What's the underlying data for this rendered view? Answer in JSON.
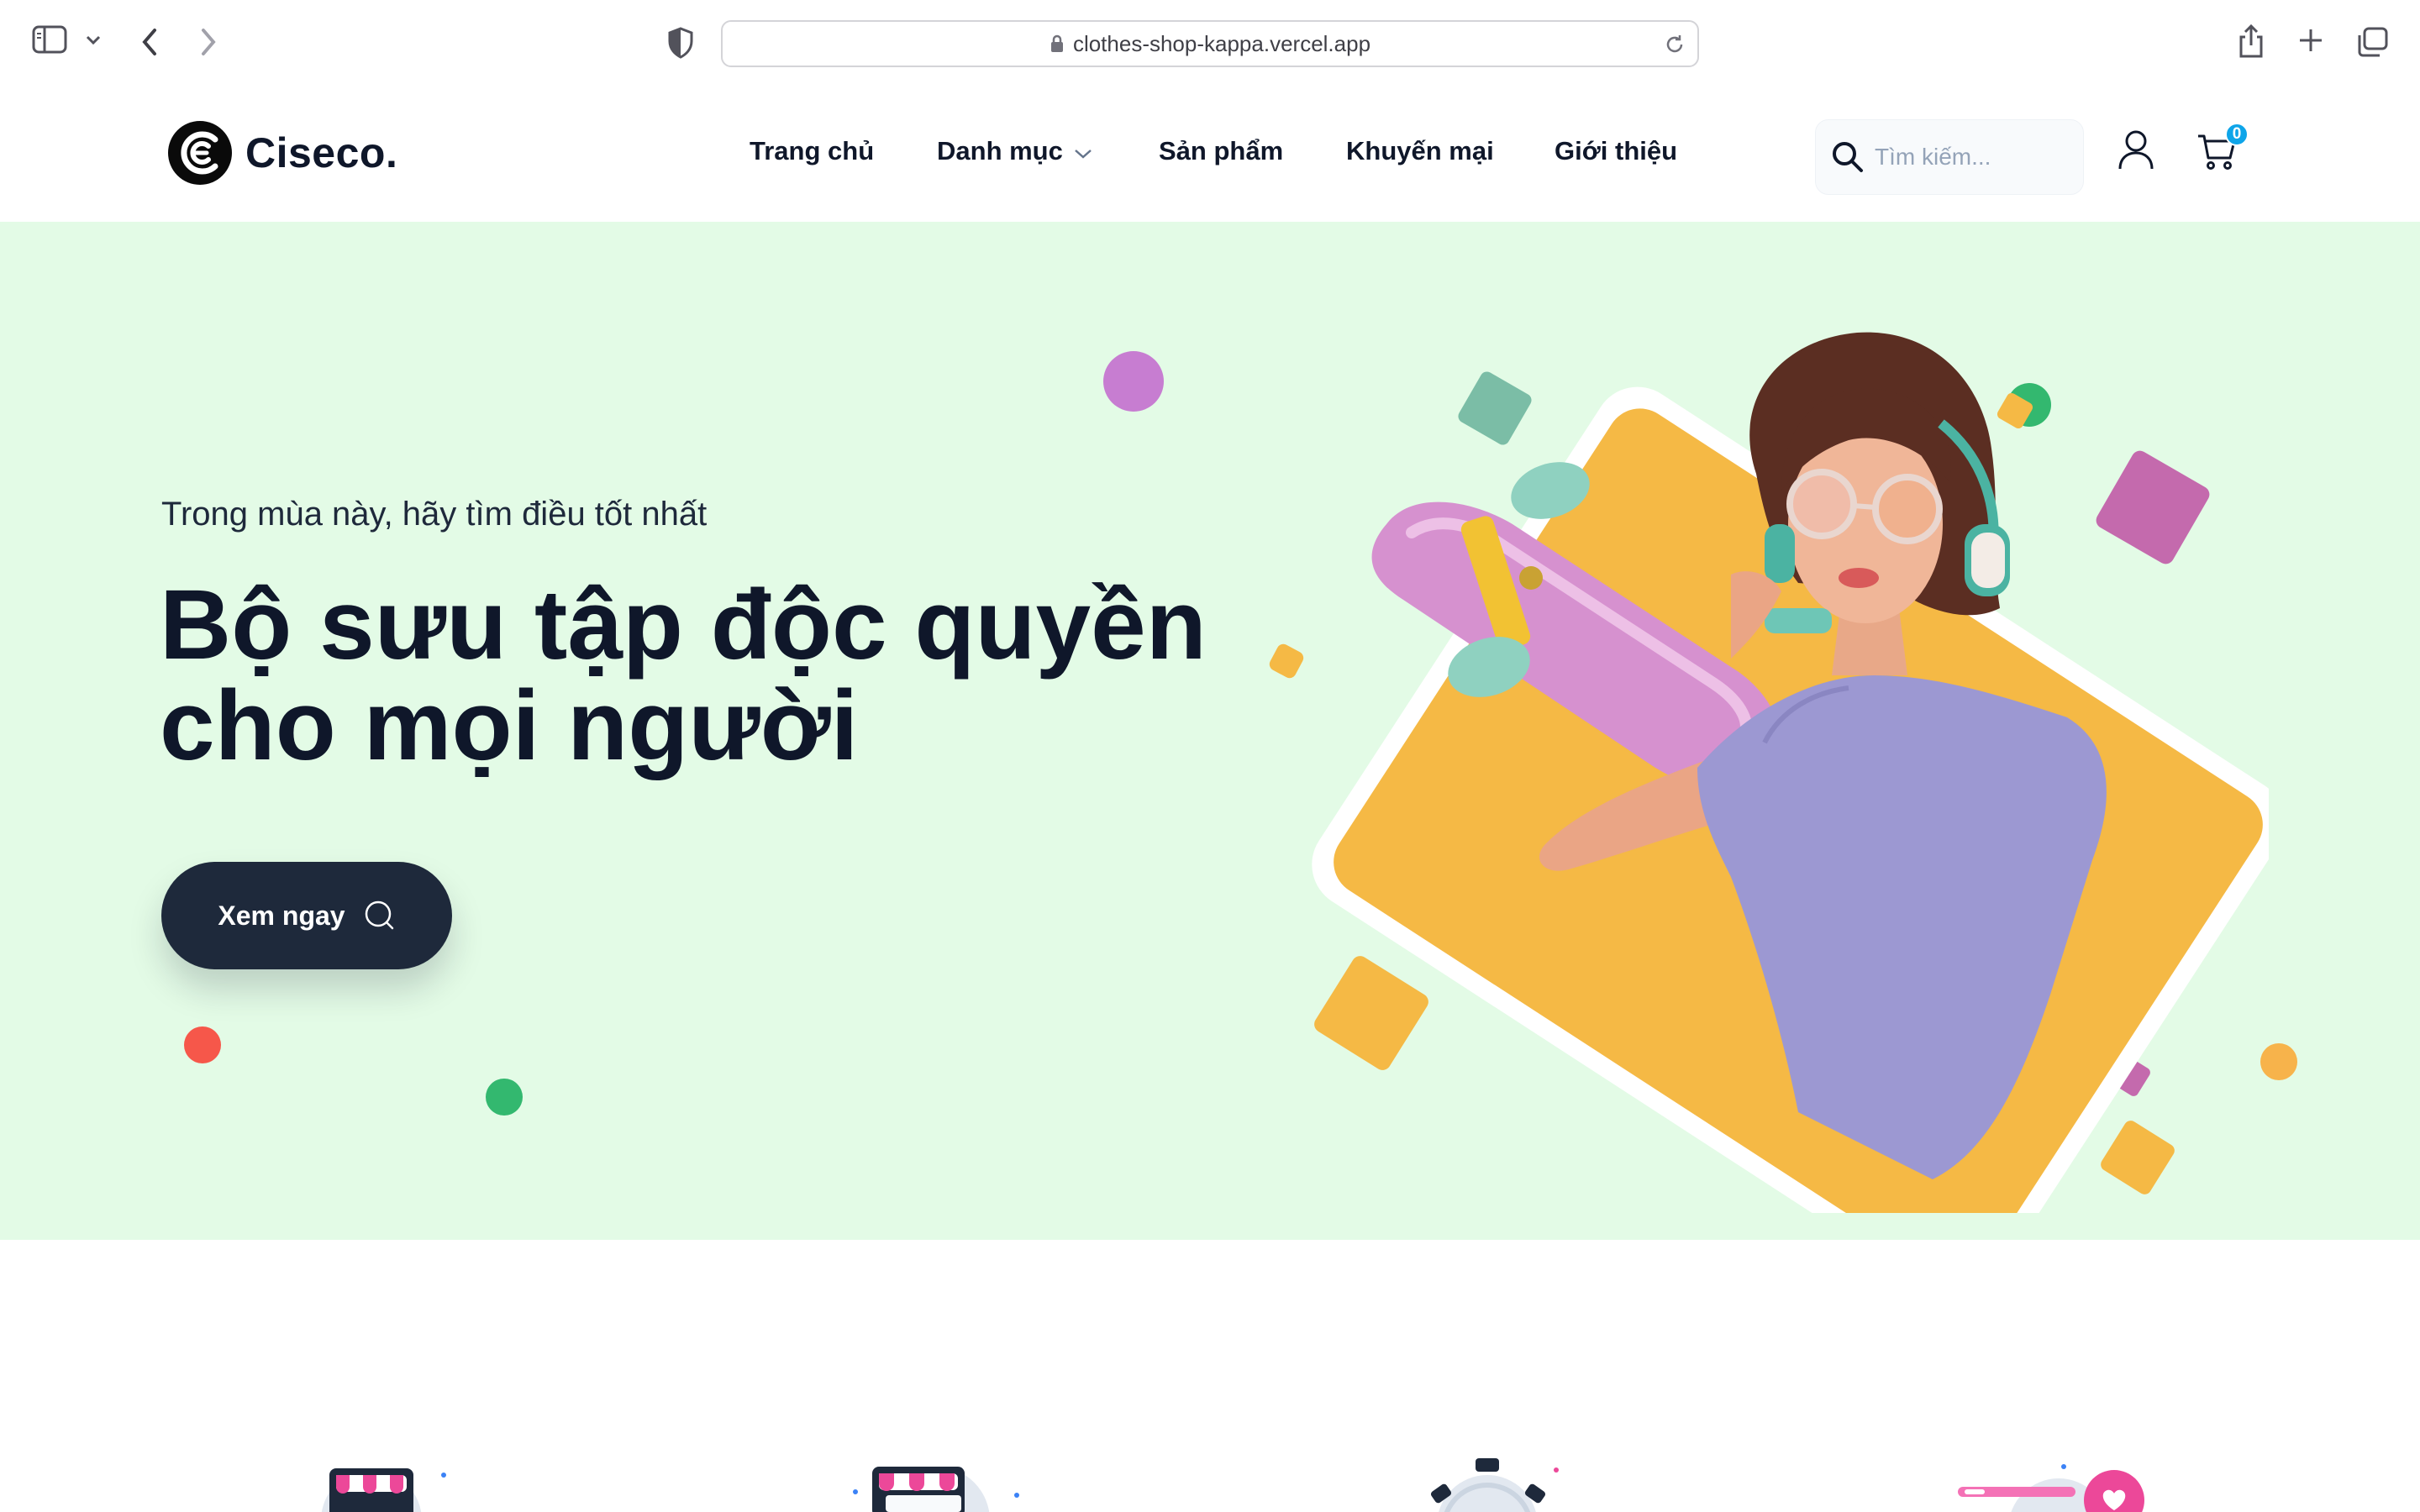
{
  "browser": {
    "url": "clothes-shop-kappa.vercel.app"
  },
  "header": {
    "logo_text": "Ciseco.",
    "nav": [
      {
        "label": "Trang chủ"
      },
      {
        "label": "Danh mục",
        "has_dropdown": true
      },
      {
        "label": "Sản phẩm"
      },
      {
        "label": "Khuyến mại"
      },
      {
        "label": "Giới thiệu"
      }
    ],
    "search_placeholder": "Tìm kiếm...",
    "cart_count": "0"
  },
  "hero": {
    "subtitle": "Trong mùa này, hãy tìm điều tốt nhất",
    "title_line1": "Bộ sưu tập độc quyền",
    "title_line2": "cho mọi người",
    "button_label": "Xem ngay"
  },
  "colors": {
    "hero_bg": "#e3fbe6",
    "button_bg": "#1e293b",
    "card_yellow": "#f5b945",
    "badge": "#0ea5e9"
  }
}
